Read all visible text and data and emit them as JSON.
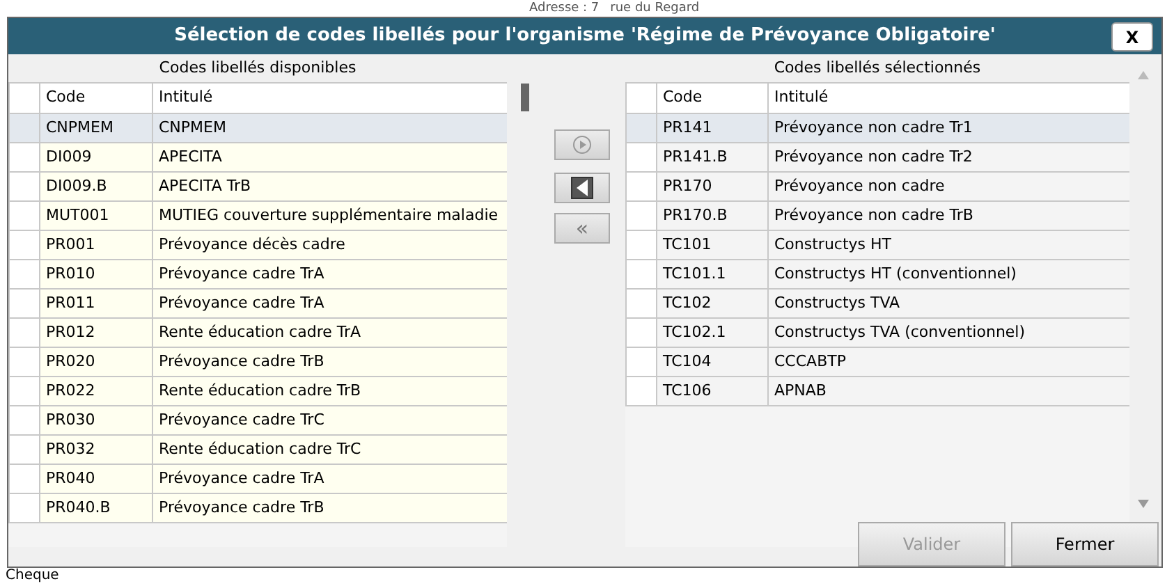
{
  "background": {
    "address_label": "Adresse : 7",
    "address_value": "rue du Regard",
    "footer_text": "Cheque"
  },
  "dialog": {
    "title": "Sélection de codes libellés pour l'organisme 'Régime de Prévoyance Obligatoire'",
    "close": "X"
  },
  "available": {
    "caption": "Codes libellés disponibles",
    "columns": [
      "Code",
      "Intitulé"
    ],
    "rows": [
      {
        "code": "CNPMEM",
        "label": "CNPMEM",
        "selected": true
      },
      {
        "code": "DI009",
        "label": "APECITA",
        "selected": false
      },
      {
        "code": "DI009.B",
        "label": "APECITA TrB",
        "selected": false
      },
      {
        "code": "MUT001",
        "label": "MUTIEG couverture supplémentaire maladie",
        "selected": false
      },
      {
        "code": "PR001",
        "label": "Prévoyance décès cadre",
        "selected": false
      },
      {
        "code": "PR010",
        "label": "Prévoyance cadre TrA",
        "selected": false
      },
      {
        "code": "PR011",
        "label": "Prévoyance cadre TrA",
        "selected": false
      },
      {
        "code": "PR012",
        "label": "Rente éducation cadre TrA",
        "selected": false
      },
      {
        "code": "PR020",
        "label": "Prévoyance cadre TrB",
        "selected": false
      },
      {
        "code": "PR022",
        "label": "Rente éducation cadre TrB",
        "selected": false
      },
      {
        "code": "PR030",
        "label": "Prévoyance cadre TrC",
        "selected": false
      },
      {
        "code": "PR032",
        "label": "Rente éducation cadre TrC",
        "selected": false
      },
      {
        "code": "PR040",
        "label": "Prévoyance cadre TrA",
        "selected": false
      },
      {
        "code": "PR040.B",
        "label": "Prévoyance cadre TrB",
        "selected": false
      }
    ]
  },
  "transfer_buttons": [
    {
      "kind": "add"
    },
    {
      "kind": "remove"
    },
    {
      "kind": "remove_all",
      "label": "«"
    }
  ],
  "selected_codes": {
    "caption": "Codes libellés sélectionnés",
    "columns": [
      "Code",
      "Intitulé"
    ],
    "rows": [
      {
        "code": "PR141",
        "label": "Prévoyance non cadre Tr1",
        "selected": true
      },
      {
        "code": "PR141.B",
        "label": "Prévoyance non cadre Tr2",
        "selected": false
      },
      {
        "code": "PR170",
        "label": "Prévoyance non cadre",
        "selected": false
      },
      {
        "code": "PR170.B",
        "label": "Prévoyance non cadre TrB",
        "selected": false
      },
      {
        "code": "TC101",
        "label": "Constructys HT",
        "selected": false
      },
      {
        "code": "TC101.1",
        "label": "Constructys HT (conventionnel)",
        "selected": false
      },
      {
        "code": "TC102",
        "label": "Constructys TVA",
        "selected": false
      },
      {
        "code": "TC102.1",
        "label": "Constructys TVA (conventionnel)",
        "selected": false
      },
      {
        "code": "TC104",
        "label": "CCCABTP",
        "selected": false
      },
      {
        "code": "TC106",
        "label": "APNAB",
        "selected": false
      }
    ]
  },
  "buttons": [
    {
      "label": "Valider",
      "disabled": true
    },
    {
      "label": "Fermer",
      "disabled": false
    }
  ]
}
